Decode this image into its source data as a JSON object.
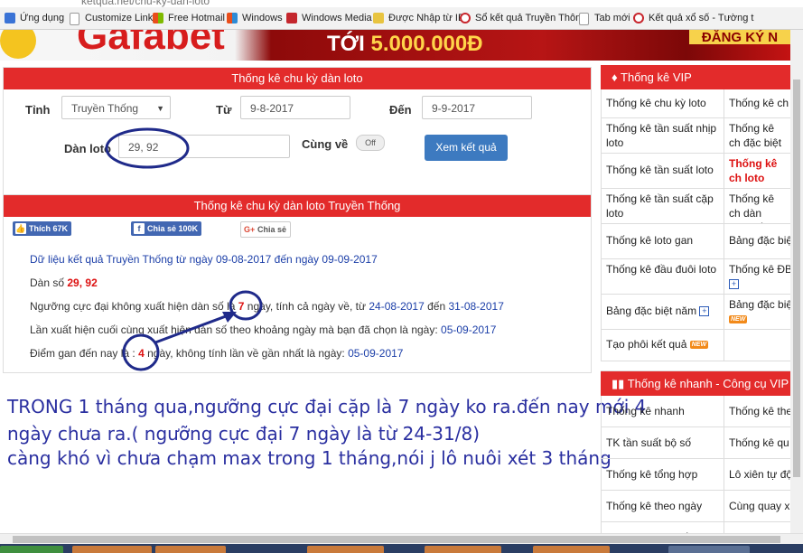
{
  "bookmarks": [
    {
      "label": "Ứng dụng",
      "color": "#3a73d6"
    },
    {
      "label": "Customize Links",
      "color": "#bbbbbb"
    },
    {
      "label": "Free Hotmail",
      "color": "#e94e1b"
    },
    {
      "label": "Windows",
      "color": "#2d8bd6"
    },
    {
      "label": "Windows Media",
      "color": "#c4262d"
    },
    {
      "label": "Được Nhập từ IE",
      "color": "#e8c440"
    },
    {
      "label": "Sổ kết quả Truyền Thôn",
      "color": "#c8262d"
    },
    {
      "label": "Tab mới",
      "color": "#bbbbbb"
    },
    {
      "label": "Kết quả xổ số - Tường t",
      "color": "#c8262d"
    }
  ],
  "url_fragment": "ketqua.net/chu-ky-dan-loto",
  "banner": {
    "brand": "Gafabet",
    "promo_prefix": "TỚI",
    "promo_amount": "5.000.000Đ",
    "cta": "ĐĂNG KÝ N"
  },
  "form": {
    "title": "Thống kê chu kỳ dàn loto",
    "province_label": "Tỉnh",
    "province_value": "Truyền Thống",
    "from_label": "Từ",
    "from_value": "9-8-2017",
    "to_label": "Đến",
    "to_value": "9-9-2017",
    "dan_label": "Dàn loto",
    "dan_value": "29, 92",
    "cungve_label": "Cùng về",
    "toggle_label": "Off",
    "submit": "Xem kết quả"
  },
  "results": {
    "title": "Thống kê chu kỳ dàn loto Truyền Thống",
    "like": "Thích 67K",
    "share": "Chia sẻ 100K",
    "gplus": "Chia sẻ",
    "data_line": "Dữ liệu kết quả Truyền Thống từ ngày 09-08-2017 đến ngày 09-09-2017",
    "dan_prefix": "Dàn số",
    "dan_numbers": "29, 92",
    "threshold_a": "Ngưỡng cực đại không xuất hiện dàn số là",
    "threshold_num": "7",
    "threshold_b": "ngày, tính cả ngày về, từ",
    "threshold_from": "24-08-2017",
    "threshold_mid": "đến",
    "threshold_to": "31-08-2017",
    "last_a": "Lần xuất hiện cuối cùng xuất hiện dàn số theo khoảng ngày mà bạn đã chọn là ngày:",
    "last_date": "05-09-2017",
    "gan_a": "Điểm gan đến nay là :",
    "gan_num": "4",
    "gan_b": "ngày, không tính lần về gần nhất là ngày:",
    "gan_date": "05-09-2017"
  },
  "note": {
    "line1": "TRONG 1 tháng qua,ngưỡng cực đại cặp là 7 ngày ko ra.đến nay mới 4",
    "line2": "ngày chưa ra.( ngưỡng cực đại 7 ngày là từ 24-31/8)",
    "line3": "càng khó vì chưa chạm max trong 1 tháng,nói j lô nuôi xét 3 tháng"
  },
  "vip": {
    "title": "Thống kê VIP",
    "rows": [
      {
        "c1": "Thống kê chu kỳ loto",
        "c2": "Thống kê ch"
      },
      {
        "c1": "Thống kê tần suất nhịp loto",
        "c2": "Thống kê ch đặc biệt"
      },
      {
        "c1": "Thống kê tần suất loto",
        "c2": "Thống kê ch loto"
      },
      {
        "c1": "Thống kê tần suất cặp loto",
        "c2": "Thống kê ch dàn cùng về"
      },
      {
        "c1": "Thống kê loto gan",
        "c2": "Bảng đặc biệ"
      },
      {
        "c1": "Thống kê đầu đuôi loto",
        "c2": "Thống kê ĐB"
      },
      {
        "c1": "Bảng đặc biệt năm",
        "c2": "Bảng đặc biệ"
      },
      {
        "c1": "Tạo phôi kết quả",
        "c2": ""
      }
    ],
    "new_badge": "NEW"
  },
  "quick": {
    "title": "Thống kê nhanh - Công cụ VIP",
    "rows": [
      {
        "c1": "Thống kê nhanh",
        "c2": "Thống kê the"
      },
      {
        "c1": "TK tần suất bộ số",
        "c2": "Thống kê qu"
      },
      {
        "c1": "Thống kê tổng hợp",
        "c2": "Lô xiên tự độ"
      },
      {
        "c1": "Thống kê theo ngày",
        "c2": "Cùng quay x"
      },
      {
        "c1": "Công cụ ghép số VIP",
        "c2": "Công cụ tách"
      }
    ]
  }
}
